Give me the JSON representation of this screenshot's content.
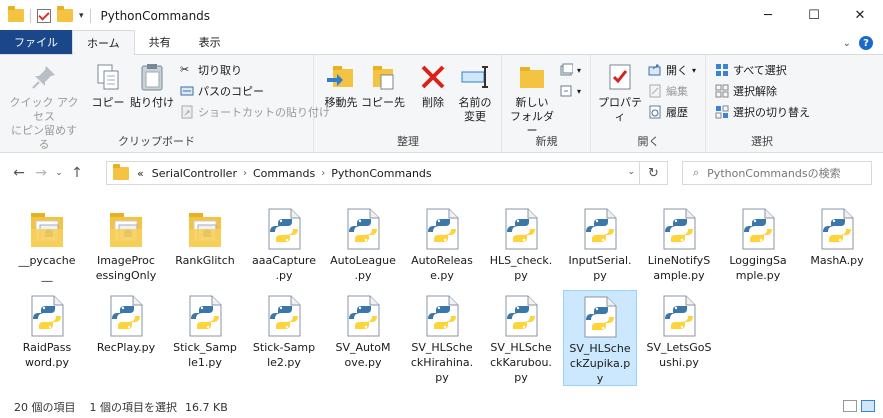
{
  "window": {
    "title": "PythonCommands",
    "minimize": "─",
    "maximize": "☐",
    "close": "✕"
  },
  "tabs": [
    {
      "label": "ファイル"
    },
    {
      "label": "ホーム"
    },
    {
      "label": "共有"
    },
    {
      "label": "表示"
    }
  ],
  "help_label": "?",
  "ribbon": {
    "clipboard": {
      "group_label": "クリップボード",
      "pin_line1": "クイック アクセス",
      "pin_line2": "にピン留めする",
      "copy": "コピー",
      "paste": "貼り付け",
      "cut": "切り取り",
      "copy_path": "パスのコピー",
      "paste_shortcut": "ショートカットの貼り付け"
    },
    "organize": {
      "group_label": "整理",
      "move_to": "移動先",
      "copy_to": "コピー先",
      "delete": "削除",
      "rename_line1": "名前の",
      "rename_line2": "変更"
    },
    "new": {
      "group_label": "新規",
      "new_folder_line1": "新しい",
      "new_folder_line2": "フォルダー"
    },
    "open": {
      "group_label": "開く",
      "properties": "プロパティ",
      "open": "開く",
      "edit": "編集",
      "history": "履歴"
    },
    "select": {
      "group_label": "選択",
      "select_all": "すべて選択",
      "select_none": "選択解除",
      "invert": "選択の切り替え"
    }
  },
  "address": {
    "prefix": "«",
    "crumbs": [
      "SerialController",
      "Commands",
      "PythonCommands"
    ]
  },
  "search": {
    "placeholder": "PythonCommandsの検索"
  },
  "files": [
    {
      "name": "__pycache__",
      "kind": "folder"
    },
    {
      "name": "ImageProcessingOnly",
      "kind": "folder"
    },
    {
      "name": "RankGlitch",
      "kind": "folder"
    },
    {
      "name": "aaaCapture.py",
      "kind": "py"
    },
    {
      "name": "AutoLeague.py",
      "kind": "py"
    },
    {
      "name": "AutoRelease.py",
      "kind": "py"
    },
    {
      "name": "HLS_check.py",
      "kind": "py"
    },
    {
      "name": "InputSerial.py",
      "kind": "py"
    },
    {
      "name": "LineNotifySample.py",
      "kind": "py"
    },
    {
      "name": "LoggingSample.py",
      "kind": "py"
    },
    {
      "name": "MashA.py",
      "kind": "py"
    },
    {
      "name": "RaidPassword.py",
      "kind": "py"
    },
    {
      "name": "RecPlay.py",
      "kind": "py"
    },
    {
      "name": "Stick_Sample1.py",
      "kind": "py"
    },
    {
      "name": "Stick-Sample2.py",
      "kind": "py"
    },
    {
      "name": "SV_AutoMove.py",
      "kind": "py"
    },
    {
      "name": "SV_HLScheckHirahina.py",
      "kind": "py"
    },
    {
      "name": "SV_HLScheckKarubou.py",
      "kind": "py"
    },
    {
      "name": "SV_HLScheckZupika.py",
      "kind": "py",
      "selected": true
    },
    {
      "name": "SV_LetsGoSushi.py",
      "kind": "py"
    }
  ],
  "file_labels": [
    "__pycache\n__",
    "ImageProc\nessingOnly",
    "RankGlitch",
    "aaaCapture\n.py",
    "AutoLeague\n.py",
    "AutoReleas\ne.py",
    "HLS_check.\npy",
    "InputSerial.\npy",
    "LineNotifyS\nample.py",
    "LoggingSa\nmple.py",
    "MashA.py",
    "RaidPass\nword.py",
    "RecPlay.py",
    "Stick_Samp\nle1.py",
    "Stick-Samp\nle2.py",
    "SV_AutoM\nove.py",
    "SV_HLSche\nckHirahina.\npy",
    "SV_HLSche\nckKarubou.\npy",
    "SV_HLSche\nckZupika.p\ny",
    "SV_LetsGoS\nushi.py"
  ],
  "status": {
    "count": "20 個の項目",
    "selected": "1 個の項目を選択",
    "size": "16.7 KB"
  },
  "colors": {
    "file_tab": "#19478a",
    "selection_bg": "#cce8ff",
    "selection_border": "#99d1ff",
    "folder": "#f5c342",
    "python_blue": "#3b77a8",
    "python_yellow": "#ffd43b"
  }
}
